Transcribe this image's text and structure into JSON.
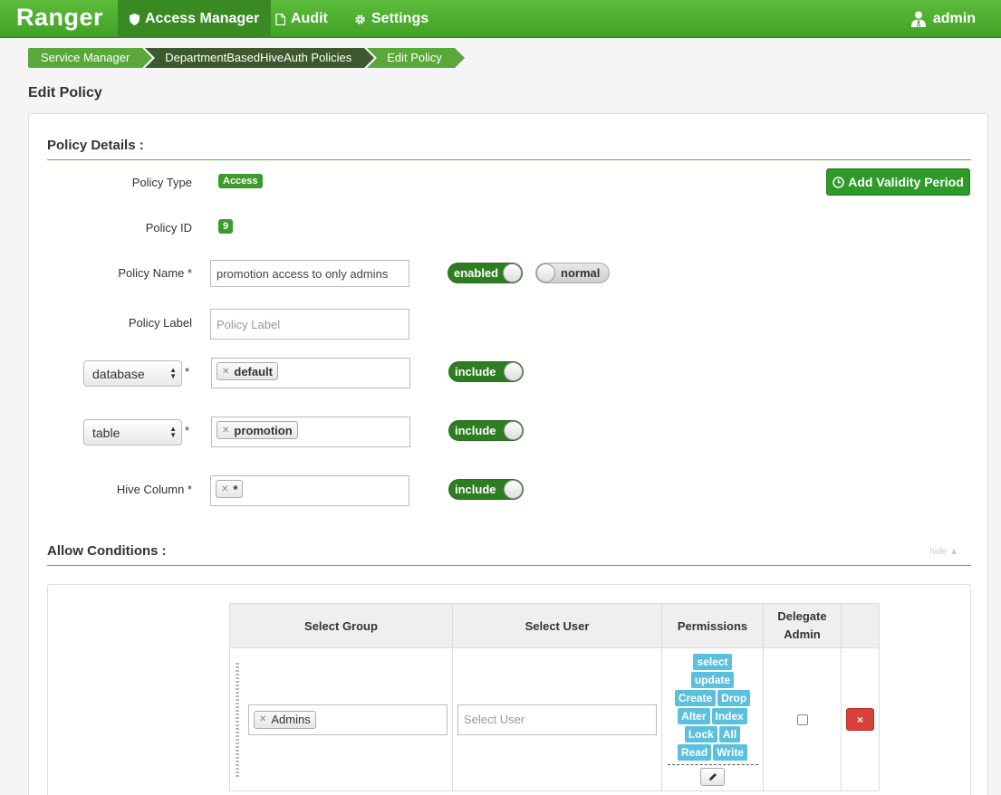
{
  "app": {
    "brand": "Ranger",
    "user": "admin"
  },
  "nav": {
    "access_manager": "Access Manager",
    "audit": "Audit",
    "settings": "Settings"
  },
  "breadcrumb": [
    "Service Manager",
    "DepartmentBasedHiveAuth Policies",
    "Edit Policy"
  ],
  "page_title": "Edit Policy",
  "policy_details": {
    "heading": "Policy Details :",
    "type_label": "Policy Type",
    "type_value": "Access",
    "id_label": "Policy ID",
    "id_value": "9",
    "name_label": "Policy Name *",
    "name_value": "promotion access to only admins",
    "enabled_toggle": "enabled",
    "normal_toggle": "normal",
    "label_label": "Policy Label",
    "label_placeholder": "Policy Label",
    "add_validity": "Add Validity Period",
    "resources": [
      {
        "selector": "database",
        "value": "default",
        "mode": "include"
      },
      {
        "selector": "table",
        "value": "promotion",
        "mode": "include"
      }
    ],
    "column_label": "Hive Column *",
    "column_value": "*",
    "column_mode": "include",
    "required_mark": "*"
  },
  "allow_conditions": {
    "heading": "Allow Conditions :",
    "hide": "hide",
    "columns": [
      "Select Group",
      "Select User",
      "Permissions",
      "Delegate Admin"
    ],
    "group_tag": "Admins",
    "user_placeholder": "Select User",
    "permissions": [
      [
        "select"
      ],
      [
        "update"
      ],
      [
        "Create",
        "Drop"
      ],
      [
        "Alter",
        "Index"
      ],
      [
        "Lock",
        "All"
      ],
      [
        "Read",
        "Write"
      ]
    ],
    "delete_glyph": "×"
  },
  "colors": {
    "nav_green": "#42a127",
    "accent_green": "#2e9a2a",
    "perm_blue": "#5bc0de",
    "danger": "#d9403a"
  }
}
